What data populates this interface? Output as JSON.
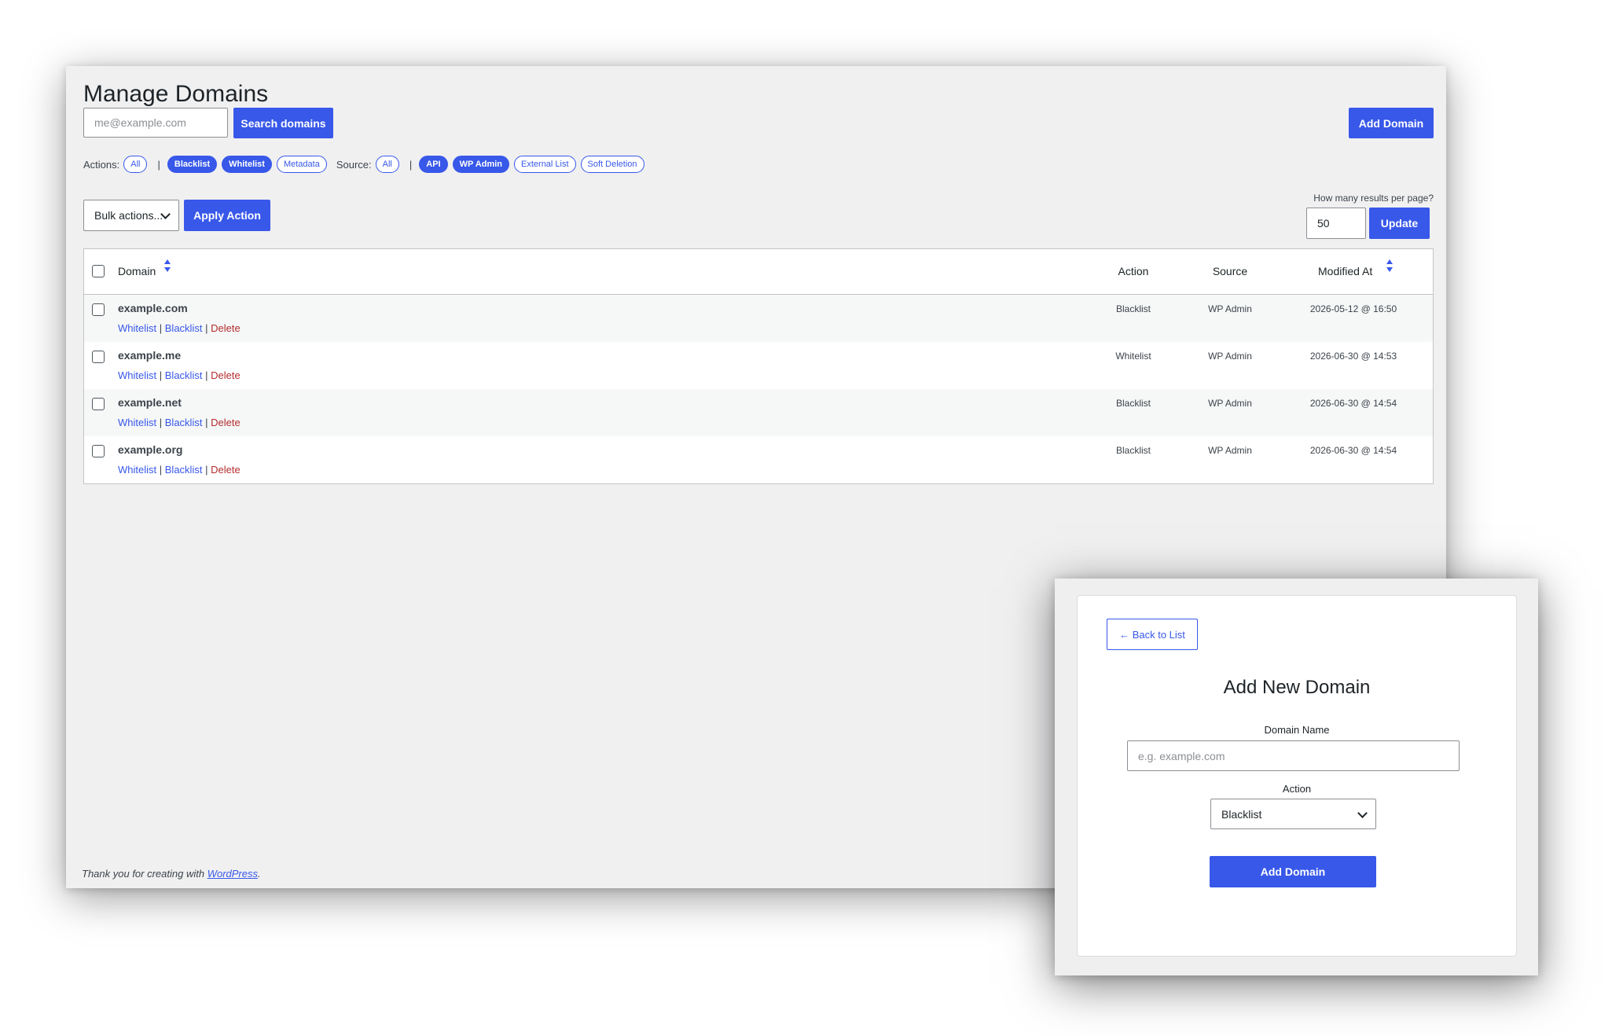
{
  "page": {
    "title": "Manage Domains",
    "search_placeholder": "me@example.com",
    "search_button": "Search domains",
    "add_button": "Add Domain",
    "accent_color": "#3858e9",
    "delete_color": "#b32d2e"
  },
  "filters": {
    "actions_label": "Actions:",
    "actions": [
      {
        "label": "All",
        "active": false
      },
      {
        "label": "Blacklist",
        "active": true
      },
      {
        "label": "Whitelist",
        "active": true
      },
      {
        "label": "Metadata",
        "active": false
      }
    ],
    "source_label": "Source:",
    "sources": [
      {
        "label": "All",
        "active": false
      },
      {
        "label": "API",
        "active": true
      },
      {
        "label": "WP Admin",
        "active": true
      },
      {
        "label": "External List",
        "active": false
      },
      {
        "label": "Soft Deletion",
        "active": false
      }
    ],
    "separator": "|"
  },
  "bulk": {
    "select_value": "Bulk actions...",
    "apply_button": "Apply Action"
  },
  "pagination": {
    "label": "How many results per page?",
    "value": "50",
    "update_button": "Update"
  },
  "table": {
    "columns": {
      "domain": "Domain",
      "action": "Action",
      "source": "Source",
      "modified": "Modified At"
    },
    "row_action_labels": {
      "whitelist": "Whitelist",
      "blacklist": "Blacklist",
      "delete": "Delete",
      "sep": "|"
    },
    "rows": [
      {
        "domain": "example.com",
        "action": "Blacklist",
        "source": "WP Admin",
        "modified": "2026-05-12 @ 16:50"
      },
      {
        "domain": "example.me",
        "action": "Whitelist",
        "source": "WP Admin",
        "modified": "2026-06-30 @ 14:53"
      },
      {
        "domain": "example.net",
        "action": "Blacklist",
        "source": "WP Admin",
        "modified": "2026-06-30 @ 14:54"
      },
      {
        "domain": "example.org",
        "action": "Blacklist",
        "source": "WP Admin",
        "modified": "2026-06-30 @ 14:54"
      }
    ]
  },
  "footer": {
    "text": "Thank you for creating with ",
    "link": "WordPress",
    "end": "."
  },
  "modal": {
    "back_button": "← Back to List",
    "title": "Add New Domain",
    "domain_label": "Domain Name",
    "domain_placeholder": "e.g. example.com",
    "action_label": "Action",
    "action_value": "Blacklist",
    "submit_button": "Add Domain"
  }
}
